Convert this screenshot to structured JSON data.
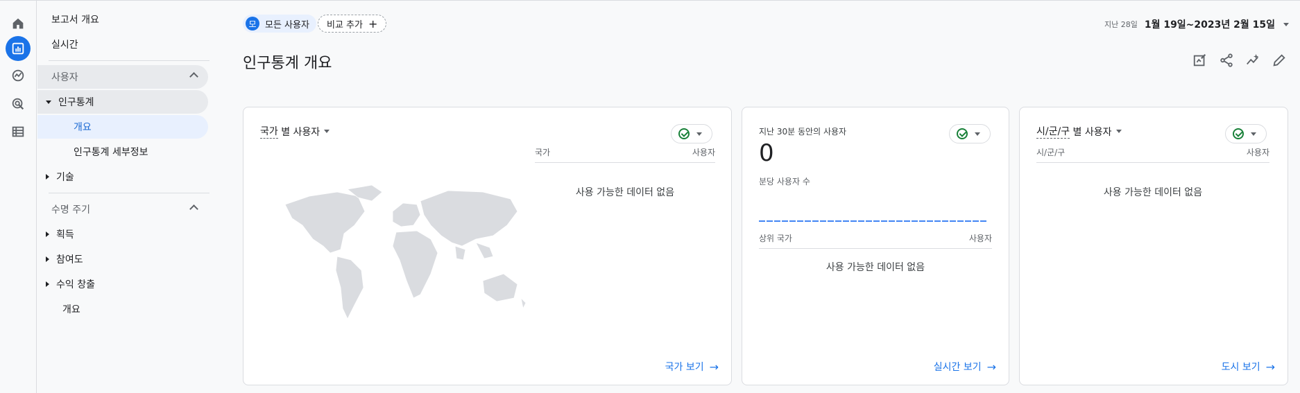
{
  "sidebar": {
    "items": [
      {
        "label": "보고서 개요"
      },
      {
        "label": "실시간"
      },
      {
        "label": "사용자"
      },
      {
        "label": "인구통계"
      },
      {
        "label": "개요"
      },
      {
        "label": "인구통계 세부정보"
      },
      {
        "label": "기술"
      },
      {
        "label": "수명 주기"
      },
      {
        "label": "획득"
      },
      {
        "label": "참여도"
      },
      {
        "label": "수익 창출"
      },
      {
        "label": "개요"
      }
    ]
  },
  "header": {
    "segment_avatar": "모",
    "segment_label": "모든 사용자",
    "compare_label": "비교 추가",
    "compare_plus": "+",
    "date_prefix": "지난 28일",
    "date_range": "1월 19일~2023년 2월 15일"
  },
  "page": {
    "title": "인구통계 개요"
  },
  "cards": {
    "country": {
      "title_dim": "국가",
      "title_rest": " 별 사용자",
      "col_left": "국가",
      "col_right": "사용자",
      "no_data": "사용 가능한 데이터 없음",
      "link": "국가 보기"
    },
    "realtime": {
      "label": "지난 30분 동안의 사용자",
      "value": "0",
      "per_minute": "분당 사용자 수",
      "col_left": "상위 국가",
      "col_right": "사용자",
      "no_data": "사용 가능한 데이터 없음",
      "link": "실시간 보기"
    },
    "city": {
      "title_dim": "시/군/구",
      "title_rest": " 별 사용자",
      "col_left": "시/군/구",
      "col_right": "사용자",
      "no_data": "사용 가능한 데이터 없음",
      "link": "도시 보기"
    }
  },
  "colors": {
    "accent": "#1a73e8",
    "success": "#188038",
    "map": "#dadce0"
  },
  "icons": [
    "home-icon",
    "reports-icon",
    "explore-icon",
    "advertising-icon",
    "table-icon",
    "customize-report-icon",
    "share-icon",
    "insights-icon",
    "edit-icon",
    "check-circle-icon",
    "world-map-icon"
  ]
}
